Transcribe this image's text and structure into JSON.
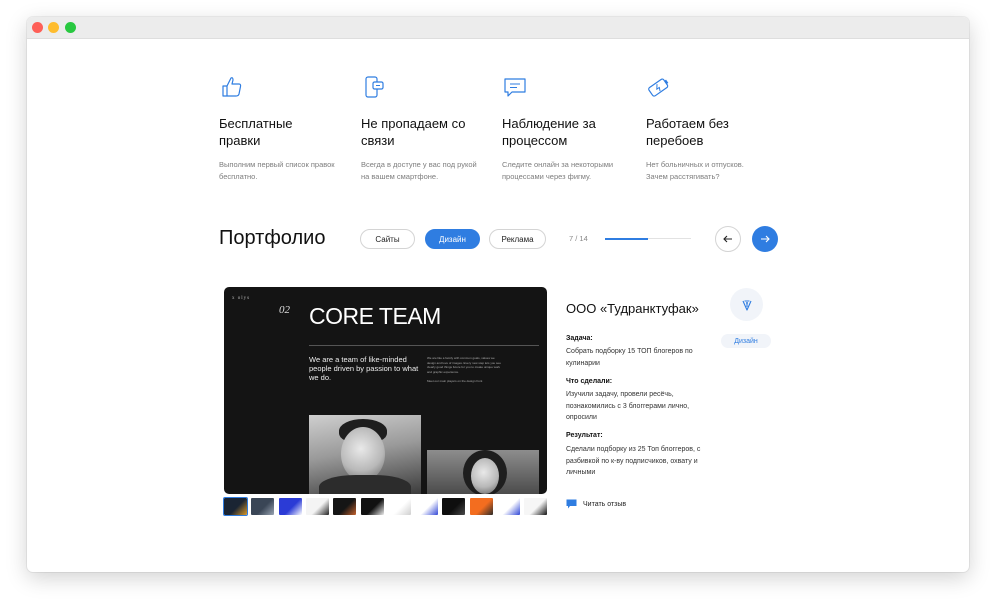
{
  "features": [
    {
      "icon": "thumbs-up-icon",
      "title": "Бесплатные правки",
      "desc": "Выполним первый список правок бесплатно."
    },
    {
      "icon": "phone-chat-icon",
      "title": "Не пропадаем со связи",
      "desc": "Всегда в доступе у вас под рукой на вашем смартфоне."
    },
    {
      "icon": "chat-bubble-icon",
      "title": "Наблюдение за процессом",
      "desc": "Следите онлайн за некоторыми процессами через фигму."
    },
    {
      "icon": "battery-icon",
      "title": "Работаем без перебоев",
      "desc": "Нет больничных и отпусков. Зачем расстягивать?"
    }
  ],
  "portfolio": {
    "title": "Портфолио",
    "filters": [
      {
        "label": "Сайты",
        "active": false
      },
      {
        "label": "Дизайн",
        "active": true
      },
      {
        "label": "Реклама",
        "active": false
      }
    ],
    "counter": "7 / 14",
    "progress": 0.5,
    "prev_icon": "arrow-left-icon",
    "next_icon": "arrow-right-icon"
  },
  "slide": {
    "brand": "x olys",
    "number": "02",
    "headline": "CORE TEAM",
    "lead": "We are a team of like-minded people driven by passion to what we do.",
    "small_text": "We are like a family with common goals, values we design and love of images. Every new step lets you see clearly good things future for you to create unique work and graphic experience.",
    "small_text_2": "Meet our main players on the design front"
  },
  "thumbnails": [
    {
      "colors": [
        "#1a2433",
        "#d99a2b"
      ],
      "selected": true
    },
    {
      "colors": [
        "#3a4656",
        "#9aa5b3"
      ],
      "selected": false
    },
    {
      "colors": [
        "#2b3bd6",
        "#ffffff"
      ],
      "selected": false
    },
    {
      "colors": [
        "#f4f4f4",
        "#222222"
      ],
      "selected": false
    },
    {
      "colors": [
        "#151515",
        "#c4622d"
      ],
      "selected": false
    },
    {
      "colors": [
        "#111111",
        "#eeeeee"
      ],
      "selected": false
    },
    {
      "colors": [
        "#ffffff",
        "#cfcfcf"
      ],
      "selected": false
    },
    {
      "colors": [
        "#ffffff",
        "#3348d6"
      ],
      "selected": false
    },
    {
      "colors": [
        "#0e0e0e",
        "#4a4a4a"
      ],
      "selected": false
    },
    {
      "colors": [
        "#f36d1f",
        "#2a2a2a"
      ],
      "selected": false
    },
    {
      "colors": [
        "#ffffff",
        "#3048d6"
      ],
      "selected": false
    },
    {
      "colors": [
        "#f6f6f6",
        "#111111"
      ],
      "selected": false
    }
  ],
  "case": {
    "client": "ООО «Тудранктуфак»",
    "task_label": "Задача:",
    "task_text": "Собрать подборку 15 ТОП блогеров по кулинарии",
    "done_label": "Что сделали:",
    "done_text": "Изучили задачу, провели ресёчь, познакомились с 3 блоггерами лично, опросили",
    "result_label": "Результат:",
    "result_text": "Сделали подборку из 25 Топ блоггеров, с разбивкой по к-ву подписчиков, охвату и личными",
    "tag": "Дизайн",
    "logo_icon": "client-logo-icon",
    "review_icon": "review-chat-icon",
    "review_label": "Читать отзыв"
  },
  "colors": {
    "accent": "#2f7de1"
  }
}
